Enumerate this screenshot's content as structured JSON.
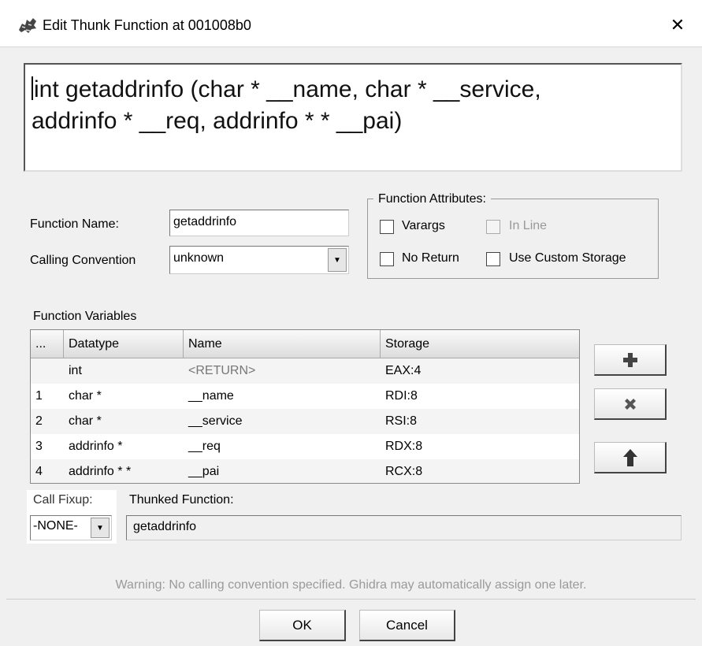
{
  "dialog": {
    "title": "Edit Thunk Function at 001008b0",
    "close_glyph": "✕"
  },
  "signature": {
    "line1": "int getaddrinfo (char * __name, char * __service,",
    "line2": "addrinfo * __req, addrinfo * * __pai)"
  },
  "function_name": {
    "label": "Function Name:",
    "value": "getaddrinfo"
  },
  "calling_convention": {
    "label": "Calling Convention",
    "value": "unknown"
  },
  "attributes": {
    "legend": "Function Attributes:",
    "varargs": "Varargs",
    "inline": "In Line",
    "no_return": "No Return",
    "custom_storage": "Use Custom Storage"
  },
  "variables": {
    "title": "Function Variables",
    "columns": [
      "...",
      "Datatype",
      "Name",
      "Storage"
    ],
    "rows": [
      {
        "index": "",
        "datatype": "int",
        "name": "<RETURN>",
        "storage": "EAX:4"
      },
      {
        "index": "1",
        "datatype": "char *",
        "name": "__name",
        "storage": "RDI:8"
      },
      {
        "index": "2",
        "datatype": "char *",
        "name": "__service",
        "storage": "RSI:8"
      },
      {
        "index": "3",
        "datatype": "addrinfo *",
        "name": "__req",
        "storage": "RDX:8"
      },
      {
        "index": "4",
        "datatype": "addrinfo * *",
        "name": "__pai",
        "storage": "RCX:8"
      }
    ]
  },
  "call_fixup": {
    "label": "Call Fixup:",
    "value": "-NONE-"
  },
  "thunked": {
    "label": "Thunked Function:",
    "value": "getaddrinfo"
  },
  "warning": "Warning: No calling convention specified. Ghidra may automatically assign one later.",
  "buttons": {
    "ok": "OK",
    "cancel": "Cancel"
  },
  "icons": {
    "title": "dragon-icon",
    "add": "plus-icon",
    "remove": "x-icon",
    "up": "arrow-up-icon"
  }
}
